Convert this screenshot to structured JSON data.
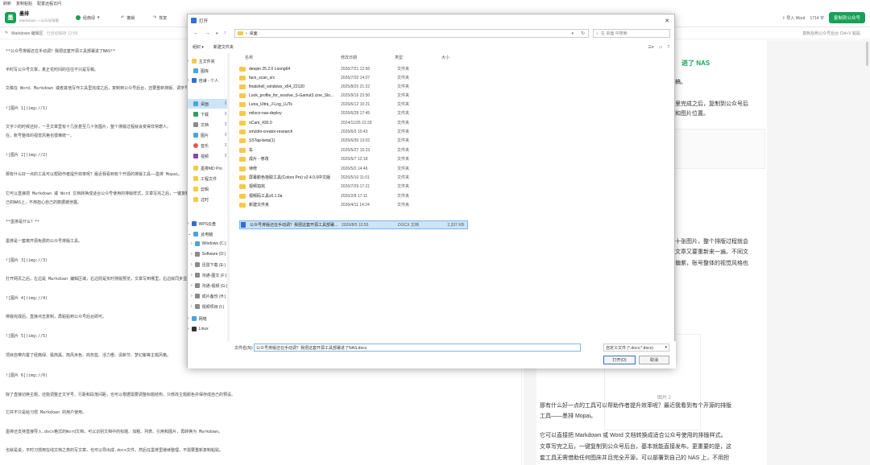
{
  "menubar": {
    "items": [
      "刷新",
      "复制粘贴",
      "配置远程访问"
    ]
  },
  "header": {
    "app_name": "墨排",
    "app_sub": "Markdown 一公众号排版",
    "theme_label": "经典绿",
    "undo_label": "撤销",
    "redo_label": "恢复",
    "import_label": "导入 Word",
    "char_count": "1714 字",
    "copy_label": "复制到公众号"
  },
  "subbar": {
    "left_label": "Markdown 编辑区",
    "left_status": "已自动保存 12:56",
    "right_hint": "复制后到公众号后台 Ctrl+V 粘贴"
  },
  "editor": {
    "lines": [
      "**公众号排版还在手动调？我把这套开源工具部署进了NAS**",
      "平时写公众号文章，真正花时间的往往不只是写稿。",
      "文稿在 Word、Markdown 或者其他写作工具里完成之后，复制到公众号后台，还要重新排版、调字号、改间距、修图片位置。",
      "![图片 1](img://1)",
      "文字少的时候还好，一旦文章里有十几张甚至几十张图片，整个排版过程就会变得非常磨人。",
      "在，账号整体的视觉风格也很难统一。",
      "![图片 2](img://2)",
      "那有什么好一点的工具可以帮助作者提升效率呢？最近我看到有个开源的排版工具——墨排 Mopai。",
      "它可以直接把 Markdown 或 Word 文档转换成适合公众号使用的排版样式，文章写完之后，一键复制到公众号后台，",
      "己的NAS上，不用担心自己的数据被泄露。",
      "**墨排是什么？**",
      "墨排是一套离开源免费的公众号排版工具。",
      "![图片 3](img://3)",
      "打开网页之后，左边是 Markdown 编辑区域，右边则是实时排版预览，文章写到哪里，右边就同步显示到哪里。",
      "![图片 4](img://4)",
      "排版完成后，直接点击复制，再粘贴到公众号后台即可。",
      "![图片 5](img://5)",
      "项目自带内置了经典绿、极简黑、简风米色、商务蓝、活力橙、清新节、梦幻紫等主题风格。",
      "![图片 6](img://6)",
      "除了直接切换主题，还能调整正文字号、行距和段落间距，也可以根据需要调整标题结构，只修改主题颜色并保存成自己的预设。",
      "它并不只是给习惯 Markdown 的用户使用。",
      "墨排还支持直接导入.docx格式的Word文档，可以识别文档中的标题、加粗、列表、引用和图片，再转换为 Markdown。",
      "也就是说，平时习惯用在线文档之类的写文章，也可以导出成.docx文件，然后在墨排里继续整理，不需要重新复制粘贴。"
    ]
  },
  "preview": {
    "heading": "进了 NAS",
    "lines": [
      "稿。",
      "里完成之后，复制到公众号后",
      "和图片位置。",
      "十张图片，整个排版过程就会",
      "文章又要重新来一遍。不同文",
      "偏紫，账号整体的视觉风格也",
      "那有什么好一点的工具可以帮助作者提升效率呢？最近我看到有个开源的排版",
      "工具——墨排 Mopai。",
      "它可以直接把 Markdown 或 Word 文档转换成适合公众号使用的排版样式。",
      "文章写完之后，一键复制到公众号后台，基本就能直接发布。更重要的是，这",
      "套工具无需借助任何图床并且完全开源，可以部署到自己的 NAS 上，不用担"
    ],
    "caption": "图片 2"
  },
  "dialog": {
    "title": "打开",
    "close": "✕",
    "address": "桌面",
    "search_placeholder": "在 桌面 中搜索",
    "toolbar": {
      "organize": "组织 ▾",
      "new_folder": "新建文件夹"
    },
    "nav": [
      {
        "label": "主文件夹",
        "color": "#f7c948",
        "pin": ""
      },
      {
        "label": "图库",
        "color": "#4aa3df",
        "pin": ""
      },
      {
        "label": "倍谦 - 个人",
        "color": "#2f6fd6",
        "pin": ""
      },
      {
        "label": "桌面",
        "color": "#4aa3df",
        "pin": "📌",
        "selected": true
      },
      {
        "label": "下载",
        "color": "#2f9e5b",
        "pin": "📌"
      },
      {
        "label": "文档",
        "color": "#8a8a8a",
        "pin": "📌"
      },
      {
        "label": "图片",
        "color": "#4aa3df",
        "pin": "📌"
      },
      {
        "label": "音乐",
        "color": "#e2574c",
        "pin": "📌"
      },
      {
        "label": "视频",
        "color": "#8e44ad",
        "pin": "📌"
      },
      {
        "label": "墨排MD Pro",
        "color": "#f7c948",
        "pin": ""
      },
      {
        "label": "工程文件",
        "color": "#f7c948",
        "pin": ""
      },
      {
        "label": "剪辑",
        "color": "#f7c948",
        "pin": ""
      },
      {
        "label": "过时",
        "color": "#f7c948",
        "pin": ""
      },
      {
        "label": "WPS云盘",
        "color": "#2f6fd6",
        "pin": ""
      },
      {
        "label": "此电脑",
        "color": "#4aa3df",
        "pin": ""
      },
      {
        "label": "Windows (C:)",
        "color": "#4aa3df",
        "pin": ""
      },
      {
        "label": "Software (D:)",
        "color": "#8a8a8a",
        "pin": ""
      },
      {
        "label": "迅雷下载 (E:)",
        "color": "#8a8a8a",
        "pin": ""
      },
      {
        "label": "沟通-图文 (F:)",
        "color": "#8a8a8a",
        "pin": ""
      },
      {
        "label": "沟通-视频 (G:)",
        "color": "#8a8a8a",
        "pin": ""
      },
      {
        "label": "成片备份 (H:)",
        "color": "#8a8a8a",
        "pin": ""
      },
      {
        "label": "视频项目 (I:)",
        "color": "#8a8a8a",
        "pin": ""
      },
      {
        "label": "网络",
        "color": "#4aa3df",
        "pin": ""
      },
      {
        "label": "Linux",
        "color": "#333333",
        "pin": ""
      }
    ],
    "columns": {
      "name": "名称",
      "date": "修改日期",
      "type": "类型",
      "size": "大小"
    },
    "files": [
      {
        "name": "deepin 25.2.0 Loong64",
        "date": "2026/7/21 12:56",
        "type": "文件夹",
        "size": ""
      },
      {
        "name": "face_scan_src",
        "date": "2026/7/20 14:07",
        "type": "文件夹",
        "size": ""
      },
      {
        "name": "finalshell_windows_x64_22120",
        "date": "2025/8/20 21:22",
        "type": "文件夹",
        "size": ""
      },
      {
        "name": "Look_profile_for_resolve_S-Gamut3.cine_Slo...",
        "date": "2025/9/16 23:50",
        "type": "文件夹",
        "size": ""
      },
      {
        "name": "Luna_Ultra_J-Log_LUTs",
        "date": "2026/6/12 10:21",
        "type": "文件夹",
        "size": ""
      },
      {
        "name": "miloco-nas-deploy",
        "date": "2026/6/28 17:45",
        "type": "文件夹",
        "size": ""
      },
      {
        "name": "oCam_430.0",
        "date": "2024/11/25 22:29",
        "type": "文件夹",
        "size": ""
      },
      {
        "name": "smzdm-creator-research",
        "date": "2026/6/3 10:43",
        "type": "文件夹",
        "size": ""
      },
      {
        "name": "SSTap-beta(1)",
        "date": "2026/6/30 13:02",
        "type": "文件夹",
        "size": ""
      },
      {
        "name": "车",
        "date": "2026/5/27 15:23",
        "type": "文件夹",
        "size": ""
      },
      {
        "name": "成片 - 修改",
        "date": "2025/5/7 12:18",
        "type": "文件夹",
        "size": ""
      },
      {
        "name": "待修",
        "date": "2026/5/2 14:46",
        "type": "文件夹",
        "size": ""
      },
      {
        "name": "屏幕颜色拾取工具(Colorx Pro) v2.4.0.0中文版",
        "date": "2026/5/10 11:01",
        "type": "文件夹",
        "size": ""
      },
      {
        "name": "视频拍完",
        "date": "2026/7/29 17:21",
        "type": "文件夹",
        "size": ""
      },
      {
        "name": "视频码工具v0.1.0a",
        "date": "2026/2/8 17:11",
        "type": "文件夹",
        "size": ""
      },
      {
        "name": "新建文件夹",
        "date": "2026/4/11 14:24",
        "type": "文件夹",
        "size": ""
      },
      {
        "name": "公众号排版还在手动调？我把这套开源工具部署...",
        "date": "2026/8/5 12:55",
        "type": "DOCX 文档",
        "size": "2,337 KB",
        "selected": true,
        "doc": true
      }
    ],
    "filename_label": "文件名(N):",
    "filename_value": "公众号排版还在手动调？我把这套开源工具部署进了NAS.docx",
    "filetype_value": "自定义文件 (*.docx;*.docx)",
    "open_label": "打开(O)",
    "cancel_label": "取消"
  }
}
